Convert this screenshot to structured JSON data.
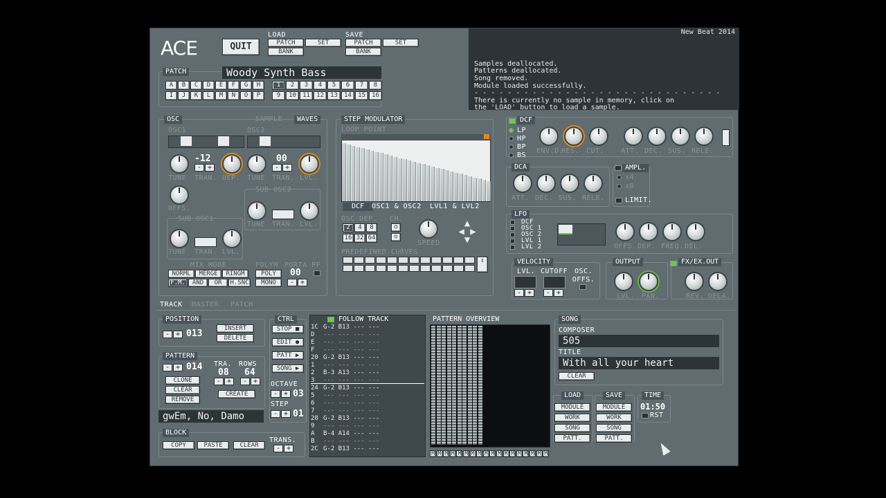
{
  "app": {
    "logo": "ACE",
    "quit_label": "QUIT"
  },
  "load_top": {
    "title": "LOAD",
    "patch": "PATCH",
    "set": "SET",
    "bank": "BANK"
  },
  "save_top": {
    "title": "SAVE",
    "patch": "PATCH",
    "set": "SET",
    "bank": "BANK"
  },
  "console": {
    "header": "New Beat 2014",
    "lines": "Samples deallocated.\nPatterns deallocated.\nSong removed.\nModule loaded successfully.\n- - - - - - - - - - - - - - - - - - - - - - - - - - - - - -\nThere is currently no sample in memory, click on\nthe 'LOAD' button to load a sample.\n\nSUPPORTED SAMPLE FORMATS: .WAV .AVR\n- - - - - - - - - - - - - - - - - - - - - - - - - - - - - -"
  },
  "patch": {
    "title": "PATCH",
    "name": "Woody Synth Bass",
    "letters_row1": [
      "A",
      "B",
      "C",
      "D",
      "E",
      "F",
      "G",
      "H"
    ],
    "letters_row2": [
      "I",
      "J",
      "K",
      "L",
      "M",
      "N",
      "O",
      "P"
    ],
    "numbers_row1": [
      "1",
      "2",
      "3",
      "4",
      "5",
      "6",
      "7",
      "8"
    ],
    "numbers_row2": [
      "9",
      "10",
      "11",
      "12",
      "13",
      "14",
      "15",
      "16"
    ]
  },
  "osc": {
    "title": "OSC",
    "sample_tab": "SAMPLE",
    "waves_tab": "WAVES",
    "osc1": "OSC1",
    "osc2": "OSC2",
    "osc1_tran": "-12",
    "osc2_tran": "00",
    "tune": "TUNE",
    "tran": "TRAN.",
    "dep": "DEP.",
    "lvl": "LVL.",
    "offs": "OFFS.",
    "sub_osc2": "SUB OSC2",
    "sub_osc1": "SUB OSC1",
    "mix_mode": "MIX MODE",
    "polym": "POLYM",
    "porta": "PORTA PF",
    "mix_buttons": [
      "NORML",
      "MERGE",
      "RINGM",
      "F.M.",
      "AND",
      "OR",
      "H.SNC"
    ],
    "poly": "POLY",
    "mono": "MONO",
    "porta_val": "00"
  },
  "step_mod": {
    "title": "STEP MODULATOR",
    "loop_point": "LOOP POINT",
    "tabs": [
      "DCF",
      "OSC1 & OSC2",
      "LVL1 & LVL2"
    ],
    "osc_dep": "OSC DEP.",
    "ch": "CH.",
    "speed": "SPEED",
    "dep_buttons": [
      "2",
      "4",
      "8",
      "16",
      "32",
      "64"
    ],
    "predefined": "PREDEFINED CURVES",
    "bars": [
      0.95,
      0.93,
      0.91,
      0.89,
      0.87,
      0.85,
      0.83,
      0.81,
      0.79,
      0.77,
      0.75,
      0.73,
      0.71,
      0.69,
      0.67,
      0.65,
      0.63,
      0.61,
      0.59,
      0.57,
      0.55,
      0.53,
      0.51,
      0.49,
      0.47,
      0.45,
      0.43,
      0.41,
      0.39,
      0.37,
      0.35,
      0.33
    ]
  },
  "dcf": {
    "title": "DCF",
    "modes": [
      "LP",
      "HP",
      "BP",
      "BS"
    ],
    "knobs": [
      "ENV.D.",
      "RES.",
      "CUT.",
      "ATT.",
      "DEC.",
      "SUS.",
      "RELE."
    ]
  },
  "dca": {
    "title": "DCA",
    "knobs": [
      "ATT.",
      "DEC.",
      "SUS.",
      "RELE."
    ],
    "ampl": "AMPL.",
    "x4": "x4",
    "x8": "x8",
    "limit": "LIMIT."
  },
  "lfo": {
    "title": "LFO",
    "targets": [
      "DCF",
      "OSC 1",
      "OSC 2",
      "LVL 1",
      "LVL 2"
    ],
    "knobs": [
      "OFFS.",
      "DEP.",
      "FREQ.",
      "DEL."
    ]
  },
  "velocity": {
    "title": "VELOCITY",
    "lvl": "LVL.",
    "cutoff": "CUTOFF",
    "osc_offs": "OSC. OFFS."
  },
  "output": {
    "title": "OUTPUT",
    "knobs": [
      "LVL.",
      "PAN."
    ]
  },
  "fx": {
    "title": "FX/EX.OUT",
    "knobs": [
      "REV.",
      "DELA."
    ]
  },
  "tabs": {
    "track": "TRACK",
    "master": "MASTER",
    "patch": "PATCH"
  },
  "position": {
    "title": "POSITION",
    "value": "013",
    "insert": "INSERT",
    "delete": "DELETE"
  },
  "pattern": {
    "title": "PATTERN",
    "value": "014",
    "tra": "TRA.",
    "rows": "ROWS",
    "tra_val": "08",
    "rows_val": "64",
    "clone": "CLONE",
    "clear": "CLEAR",
    "remove": "REMOVE",
    "create": "CREATE",
    "name": "gwEm, No, Damo"
  },
  "ctrl": {
    "title": "CTRL",
    "stop": "STOP",
    "edit": "EDIT",
    "patt": "PATT",
    "song": "SONG",
    "octave": "OCTAVE",
    "octave_val": "03",
    "step": "STEP",
    "step_val": "01"
  },
  "block": {
    "title": "BLOCK",
    "copy": "COPY",
    "paste": "PASTE",
    "clear": "CLEAR",
    "trans": "TRANS."
  },
  "follow": {
    "title": "FOLLOW TRACK",
    "rows": [
      {
        "n": "1C",
        "t": "G-2 B13 --- ---"
      },
      {
        "n": "D",
        "t": "--- --- --- ---"
      },
      {
        "n": "E",
        "t": "--- --- --- ---"
      },
      {
        "n": "F",
        "t": "--- --- --- ---"
      },
      {
        "n": "20",
        "t": "G-2 B13 --- ---"
      },
      {
        "n": "1",
        "t": "--- --- --- ---"
      },
      {
        "n": "2",
        "t": "B-3 A13 --- ---"
      },
      {
        "n": "3",
        "t": "--- --- --- ---"
      },
      {
        "n": "24",
        "t": "G-2 B13 --- ---"
      },
      {
        "n": "5",
        "t": "--- --- --- ---"
      },
      {
        "n": "6",
        "t": "--- --- --- ---"
      },
      {
        "n": "7",
        "t": "--- --- --- ---"
      },
      {
        "n": "28",
        "t": "G-2 B13 --- ---"
      },
      {
        "n": "9",
        "t": "--- --- --- ---"
      },
      {
        "n": "A",
        "t": "B-4 A14 --- ---"
      },
      {
        "n": "B",
        "t": "--- --- --- ---"
      },
      {
        "n": "2C",
        "t": "G-2 B13 --- ---"
      }
    ]
  },
  "overview": {
    "title": "PATTERN OVERVIEW",
    "mute_label": "M"
  },
  "song": {
    "title": "SONG",
    "composer_label": "COMPOSER",
    "composer": "505",
    "title_label": "TITLE",
    "title_value": "With all your heart",
    "clear": "CLEAR"
  },
  "file_load": {
    "title": "LOAD",
    "items": [
      "MODULE",
      "WORK",
      "SONG",
      "PATT."
    ]
  },
  "file_save": {
    "title": "SAVE",
    "items": [
      "MODULE",
      "WORK",
      "SONG",
      "PATT."
    ]
  },
  "time": {
    "title": "TIME",
    "value": "01:50",
    "rst": "RST"
  },
  "colors": {
    "panel": "#606c70",
    "lcd": "#2d3437",
    "accent_orange": "#e08a1c",
    "accent_green": "#64d040"
  }
}
